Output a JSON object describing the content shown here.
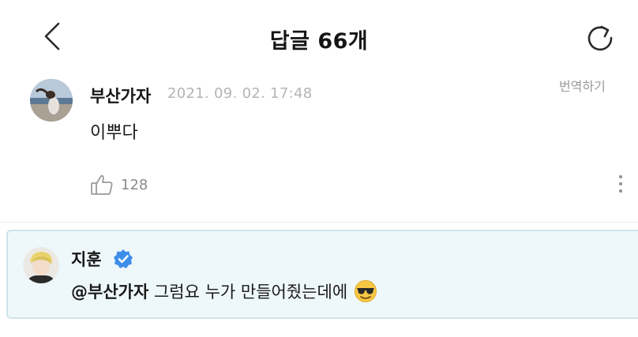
{
  "header": {
    "title": "답글 66개",
    "back_icon": "chevron-left-icon",
    "refresh_icon": "refresh-icon"
  },
  "comment": {
    "author": "부산가자",
    "timestamp": "2021. 09. 02. 17:48",
    "translate_label": "번역하기",
    "text": "이뿌다",
    "like_count": "128",
    "like_icon": "thumbs-up-icon",
    "more_icon": "more-vertical-icon"
  },
  "reply": {
    "author": "지훈",
    "verified_icon": "verified-badge-icon",
    "mention": "@부산가자",
    "text": " 그럼요 누가 만들어줬는데에",
    "emoji": "😎",
    "colors": {
      "background": "#eef8fb",
      "border": "#cfe3ec",
      "verified": "#3d8ee8"
    }
  }
}
